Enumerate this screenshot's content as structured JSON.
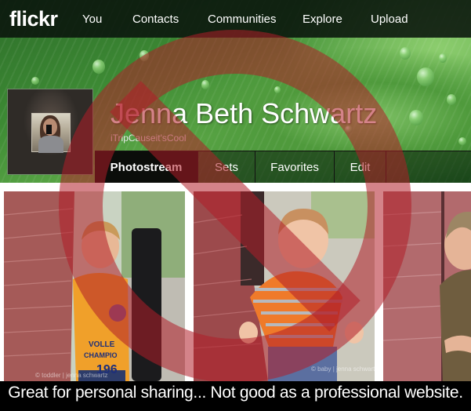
{
  "topnav": {
    "logo": "flickr",
    "items": [
      {
        "label": "You"
      },
      {
        "label": "Contacts"
      },
      {
        "label": "Communities"
      },
      {
        "label": "Explore"
      },
      {
        "label": "Upload"
      }
    ]
  },
  "profile": {
    "name": "Jenna Beth Schwartz",
    "username": "iTripCauseit'sCool",
    "avatar_icon": "user-avatar"
  },
  "tabs": [
    {
      "label": "Photostream",
      "active": true
    },
    {
      "label": "Sets",
      "active": false
    },
    {
      "label": "Favorites",
      "active": false
    },
    {
      "label": "Edit",
      "active": false
    }
  ],
  "photos": [
    {
      "description": "Toddler boy in orange polo shirt leaning against brick wall next to black pole",
      "watermark": "© toddler | jenna schwartz"
    },
    {
      "description": "Baby boy in orange and grey striped shirt walking beside brick wall",
      "watermark": "© baby | jenna schwartz"
    },
    {
      "description": "Smiling boy in brown t-shirt with arms crossed leaning on brick wall",
      "watermark": ""
    }
  ],
  "overlay": {
    "symbol": "prohibition-sign",
    "color": "#b01e28",
    "caption": "Great for personal sharing... Not good as a professional website."
  }
}
